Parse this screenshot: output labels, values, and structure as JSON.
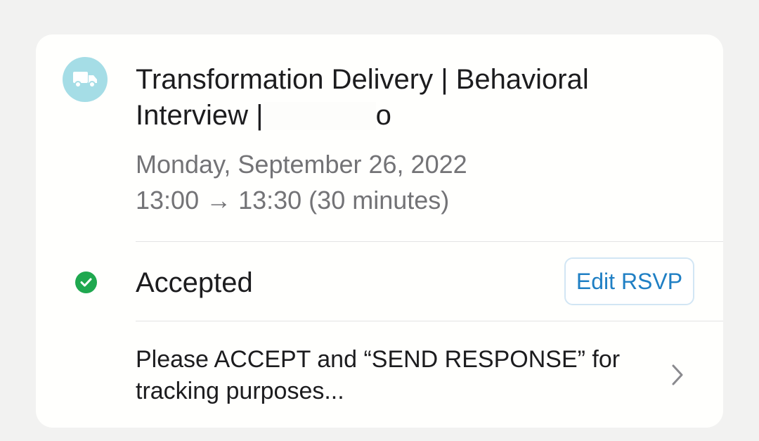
{
  "event": {
    "icon": "delivery-truck-icon",
    "icon_color": "#a5dde6",
    "title": "Transformation Delivery | Behavioral Interview |",
    "title_tail": "o",
    "date": "Monday, September 26, 2022",
    "time": "13:00 → 13:30 (30 minutes)"
  },
  "rsvp": {
    "status_icon": "check-circle-icon",
    "status_color": "#1fa84f",
    "status": "Accepted",
    "edit_label": "Edit RSVP",
    "accent": "#1f7fc4"
  },
  "note": {
    "text": "Please ACCEPT and “SEND RESPONSE” for tracking purposes...",
    "icon": "chevron-right-icon"
  }
}
